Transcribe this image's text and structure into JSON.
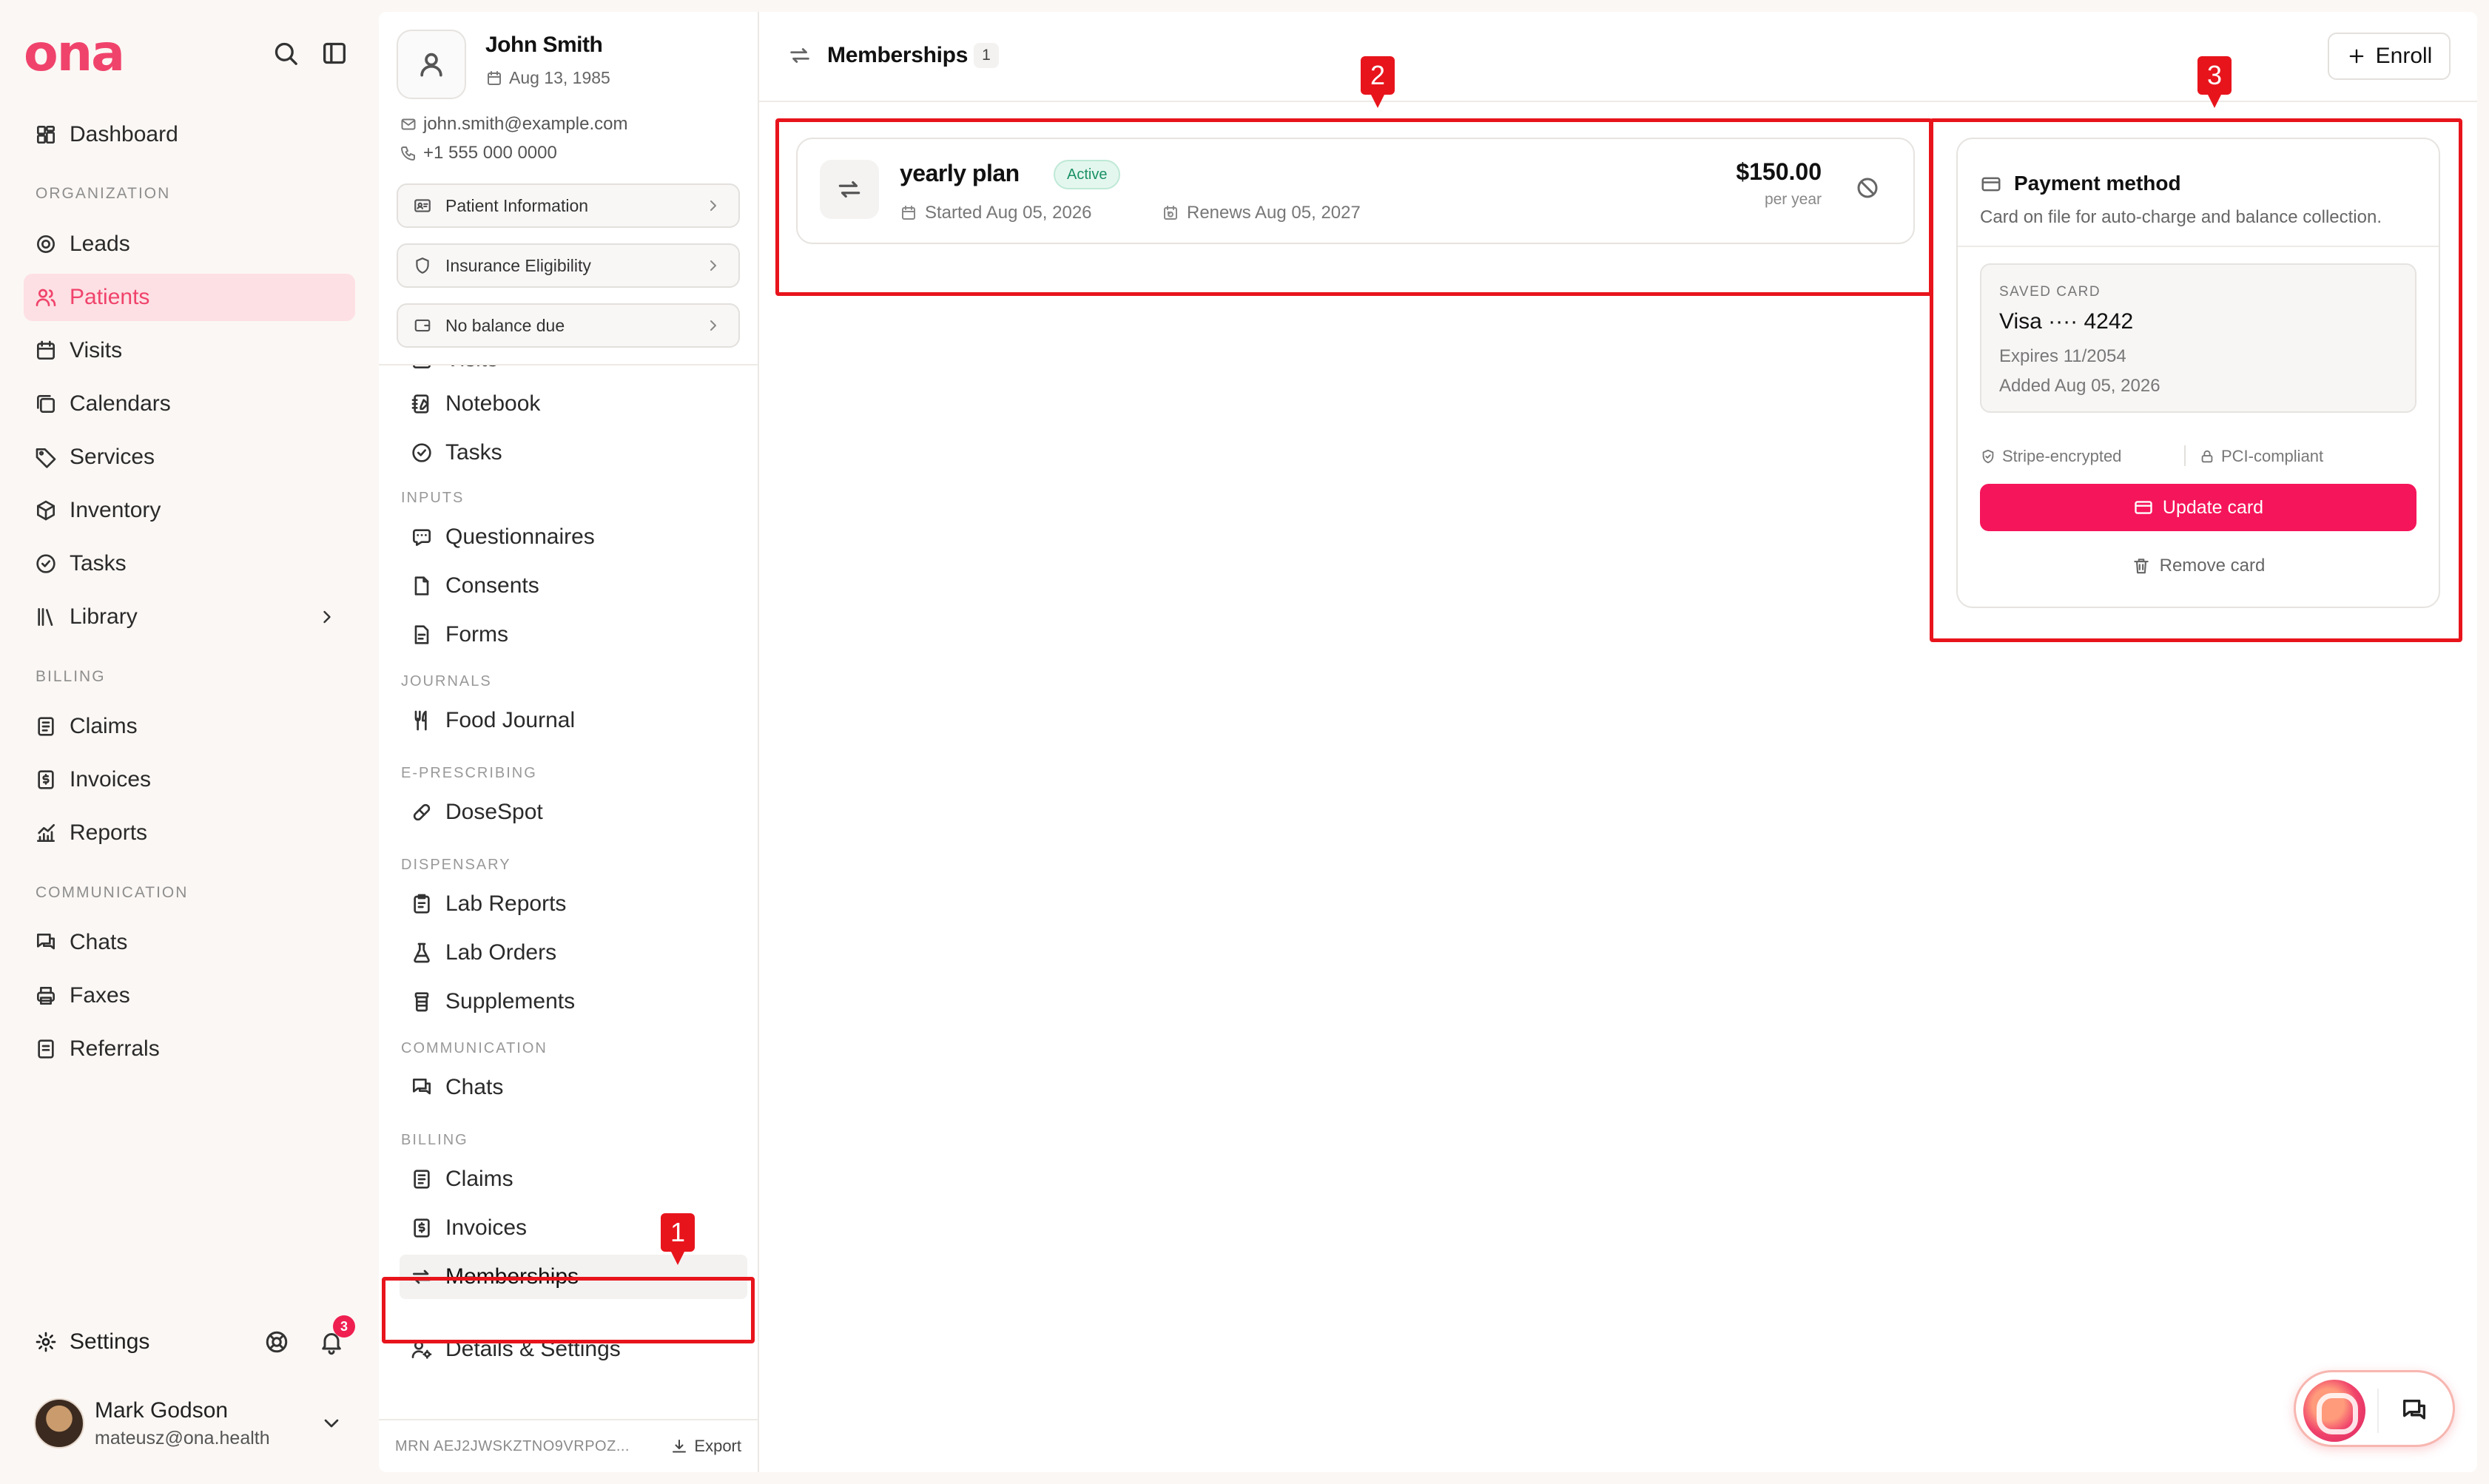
{
  "app": {
    "logo": "ona"
  },
  "sidebar": {
    "items": [
      {
        "label": "Dashboard"
      },
      {
        "label": "Leads"
      },
      {
        "label": "Patients"
      },
      {
        "label": "Visits"
      },
      {
        "label": "Calendars"
      },
      {
        "label": "Services"
      },
      {
        "label": "Inventory"
      },
      {
        "label": "Tasks"
      },
      {
        "label": "Library"
      },
      {
        "label": "Claims"
      },
      {
        "label": "Invoices"
      },
      {
        "label": "Reports"
      },
      {
        "label": "Chats"
      },
      {
        "label": "Faxes"
      },
      {
        "label": "Referrals"
      }
    ],
    "sections": {
      "organization": "ORGANIZATION",
      "billing": "BILLING",
      "communication": "COMMUNICATION"
    },
    "settings_label": "Settings",
    "notification_count": "3",
    "user": {
      "name": "Mark Godson",
      "email": "mateusz@ona.health"
    }
  },
  "patient": {
    "name": "John Smith",
    "dob": "Aug 13, 1985",
    "email": "john.smith@example.com",
    "phone": "+1 555 000 0000",
    "buttons": {
      "info": "Patient Information",
      "insurance": "Insurance Eligibility",
      "balance": "No balance due"
    },
    "menu": {
      "visits": "Visits",
      "notebook": "Notebook",
      "tasks": "Tasks",
      "inputs_section": "INPUTS",
      "questionnaires": "Questionnaires",
      "consents": "Consents",
      "forms": "Forms",
      "journals_section": "JOURNALS",
      "food_journal": "Food Journal",
      "eprescribing_section": "E-PRESCRIBING",
      "dosespot": "DoseSpot",
      "dispensary_section": "DISPENSARY",
      "lab_reports": "Lab Reports",
      "lab_orders": "Lab Orders",
      "supplements": "Supplements",
      "communication_section": "COMMUNICATION",
      "chats": "Chats",
      "billing_section": "BILLING",
      "claims": "Claims",
      "invoices": "Invoices",
      "memberships": "Memberships",
      "details_settings": "Details & Settings"
    },
    "mrn": "MRN AEJ2JWSKZTNO9VRPOZ...",
    "export_label": "Export"
  },
  "main": {
    "title": "Memberships",
    "count": "1",
    "enroll_label": "Enroll",
    "membership": {
      "name": "yearly plan",
      "status": "Active",
      "started": "Started Aug 05, 2026",
      "renews": "Renews Aug 05, 2027",
      "price": "$150.00",
      "period": "per year",
      "status_color": "#1a9164"
    },
    "payment": {
      "title": "Payment method",
      "description": "Card on file for auto-charge and balance collection.",
      "saved_label": "SAVED CARD",
      "card": "Visa ···· 4242",
      "expires": "Expires 11/2054",
      "added": "Added Aug 05, 2026",
      "badge1": "Stripe-encrypted",
      "badge2": "PCI-compliant",
      "update_label": "Update card",
      "remove_label": "Remove card",
      "accent": "#f5155a"
    }
  },
  "annotations": [
    "1",
    "2",
    "3"
  ]
}
